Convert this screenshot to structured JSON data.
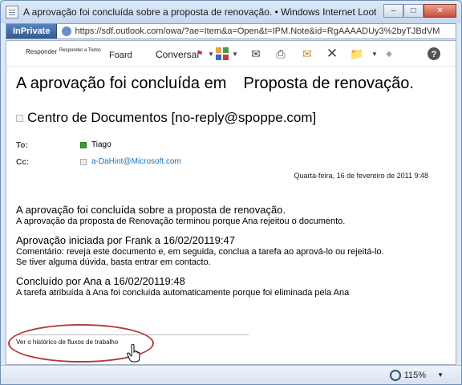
{
  "window": {
    "title": "A aprovação foi concluída sobre a proposta de renovação. • Windows Internet Looter • InPrivatel"
  },
  "address": {
    "inprivate_label": "InPrivate",
    "url": "https://sdf.outlook.com/owa/?ae=Item&a=Open&t=IPM.Note&id=RgAAAADUy3%2byTJBdVM"
  },
  "toolbar": {
    "reply": "Responder",
    "reply_all": "Responder a Todos",
    "forward": "Foard",
    "conversation": "Conversar"
  },
  "message": {
    "subject_part1": "A aprovação foi concluída em",
    "subject_part2": "Proposta de renovação.",
    "from": "Centro de Documentos [no-reply@spoppe.com]",
    "to_label": "To:",
    "to_value": "Tiago",
    "cc_label": "Cc:",
    "cc_value": "a-DaHint@Microsoft.com",
    "date": "Quarta-feira, 16 de fevereiro de 2011 9:48"
  },
  "body": {
    "line1": "A aprovação foi concluída sobre a proposta de renovação.",
    "line2": "A aprovação da proposta de Renovação terminou porque Ana rejeitou o documento.",
    "line3": "Aprovação iniciada por Frank a 16/02/20119:47",
    "line4": "Comentário: reveja este documento e, em seguida, conclua a tarefa ao aprová-lo ou rejeitá-lo.",
    "line5": "Se tiver alguma dúvida, basta entrar em contacto.",
    "line6": "Concluído por Ana a 16/02/20119:48",
    "line7": "A tarefa atribuída à Ana foi concluída automaticamente porque foi eliminada pela Ana",
    "history_link": "Ver o histórico de fluxos de trabalho"
  },
  "status": {
    "zoom": "115%"
  }
}
